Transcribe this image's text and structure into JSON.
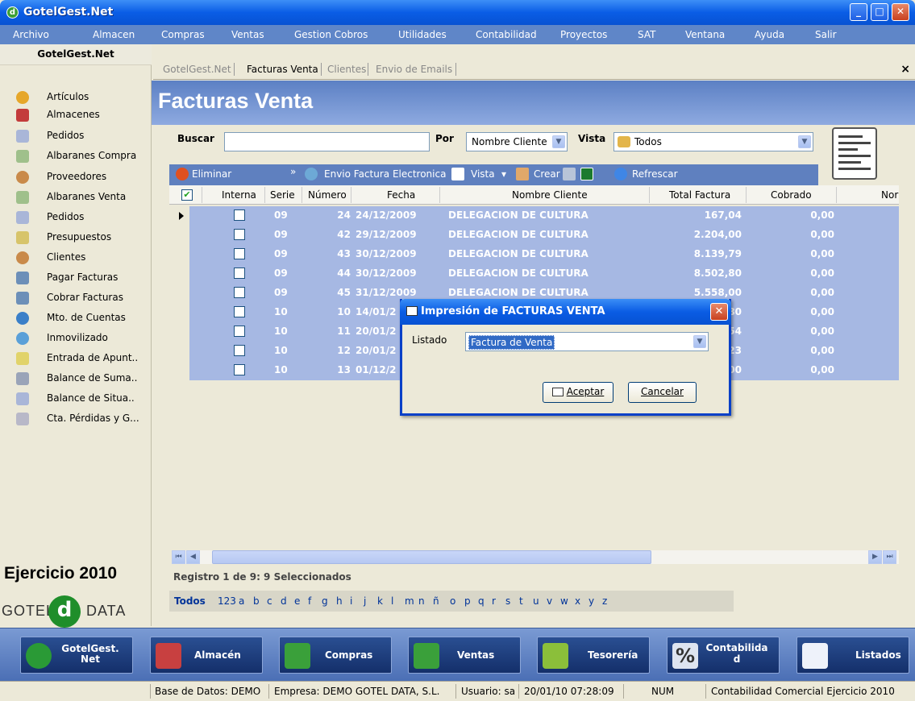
{
  "window": {
    "title": "GotelGest.Net",
    "min": "_",
    "max": "□",
    "close": "✕"
  },
  "menu": [
    {
      "label": "Archivo"
    },
    {
      "label": "Almacen"
    },
    {
      "label": "Compras"
    },
    {
      "label": "Ventas"
    },
    {
      "label": "Gestion Cobros"
    },
    {
      "label": "Utilidades"
    },
    {
      "label": "Contabilidad"
    },
    {
      "label": "Proyectos"
    },
    {
      "label": "SAT"
    },
    {
      "label": "Ventana"
    },
    {
      "label": "Ayuda"
    },
    {
      "label": "Salir"
    }
  ],
  "sidebar": {
    "header": "GotelGest.Net",
    "items": [
      {
        "label": "Artículos"
      },
      {
        "label": "Almacenes"
      },
      {
        "label": "Pedidos"
      },
      {
        "label": "Albaranes Compra"
      },
      {
        "label": "Proveedores"
      },
      {
        "label": "Albaranes Venta"
      },
      {
        "label": "Pedidos"
      },
      {
        "label": "Presupuestos"
      },
      {
        "label": "Clientes"
      },
      {
        "label": "Pagar Facturas"
      },
      {
        "label": "Cobrar Facturas"
      },
      {
        "label": "Mto. de Cuentas"
      },
      {
        "label": "Inmovilizado"
      },
      {
        "label": "Entrada de Apunt.."
      },
      {
        "label": "Balance de Suma.."
      },
      {
        "label": "Balance de Situa.."
      },
      {
        "label": "Cta. Pérdidas y G..."
      }
    ],
    "ejercicio": "Ejercicio 2010",
    "logo_left": "GOTEL",
    "logo_mid": "d",
    "logo_right": "DATA"
  },
  "tabs": [
    {
      "label": "GotelGest.Net"
    },
    {
      "label": "Facturas Venta"
    },
    {
      "label": "Clientes"
    },
    {
      "label": "Envio de Emails"
    }
  ],
  "tab_close": "×",
  "page_title": "Facturas Venta",
  "search": {
    "label": "Buscar",
    "value": "",
    "por_label": "Por",
    "por_value": "Nombre Cliente",
    "vista_label": "Vista",
    "vista_value": "Todos"
  },
  "toolbar": {
    "eliminar": "Eliminar",
    "envio": "Envio Factura Electronica",
    "vista": "Vista",
    "crear": "Crear",
    "refrescar": "Refrescar"
  },
  "grid": {
    "headers": [
      "Interna",
      "Serie",
      "Número",
      "Fecha",
      "Nombre Cliente",
      "Total Factura",
      "Cobrado",
      "Nor"
    ],
    "rows": [
      {
        "serie": "09",
        "numero": "24",
        "fecha": "24/12/2009",
        "cliente": "DELEGACION DE CULTURA",
        "total": "167,04",
        "cobrado": "0,00"
      },
      {
        "serie": "09",
        "numero": "42",
        "fecha": "29/12/2009",
        "cliente": "DELEGACION DE CULTURA",
        "total": "2.204,00",
        "cobrado": "0,00"
      },
      {
        "serie": "09",
        "numero": "43",
        "fecha": "30/12/2009",
        "cliente": "DELEGACION DE CULTURA",
        "total": "8.139,79",
        "cobrado": "0,00"
      },
      {
        "serie": "09",
        "numero": "44",
        "fecha": "30/12/2009",
        "cliente": "DELEGACION DE CULTURA",
        "total": "8.502,80",
        "cobrado": "0,00"
      },
      {
        "serie": "09",
        "numero": "45",
        "fecha": "31/12/2009",
        "cliente": "DELEGACION DE CULTURA",
        "total": "5.558,00",
        "cobrado": "0,00"
      },
      {
        "serie": "10",
        "numero": "10",
        "fecha": "14/01/2",
        "cliente": "",
        "total": "80",
        "cobrado": "0,00"
      },
      {
        "serie": "10",
        "numero": "11",
        "fecha": "20/01/2",
        "cliente": "",
        "total": "54",
        "cobrado": "0,00"
      },
      {
        "serie": "10",
        "numero": "12",
        "fecha": "20/01/2",
        "cliente": "",
        "total": "23",
        "cobrado": "0,00"
      },
      {
        "serie": "10",
        "numero": "13",
        "fecha": "01/12/2",
        "cliente": "",
        "total": "00",
        "cobrado": "0,00"
      }
    ]
  },
  "scroll": {
    "first": "⏮",
    "prev": "◀",
    "next": "▶",
    "last": "⏭"
  },
  "reginfo": "Registro 1 de 9: 9 Seleccionados",
  "alpha": [
    "Todos",
    "123",
    "a",
    "b",
    "c",
    "d",
    "e",
    "f",
    "g",
    "h",
    "i",
    "j",
    "k",
    "l",
    "m",
    "n",
    "ñ",
    "o",
    "p",
    "q",
    "r",
    "s",
    "t",
    "u",
    "v",
    "w",
    "x",
    "y",
    "z"
  ],
  "bottom": [
    {
      "label": "GotelGest. Net"
    },
    {
      "label": "Almacén"
    },
    {
      "label": "Compras"
    },
    {
      "label": "Ventas"
    },
    {
      "label": "Tesorería"
    },
    {
      "label": "Contabilida d"
    },
    {
      "label": "Listados"
    }
  ],
  "status": {
    "db": "Base de Datos: DEMO",
    "empresa": "Empresa: DEMO GOTEL DATA, S.L.",
    "usuario": "Usuario: sa",
    "datetime": "20/01/10 07:28:09",
    "num": "NUM",
    "info": "Contabilidad Comercial Ejercicio 2010"
  },
  "dialog": {
    "title": "Impresión de FACTURAS VENTA",
    "listado_label": "Listado",
    "listado_value": "Factura de Venta",
    "aceptar": "Aceptar",
    "cancelar": "Cancelar",
    "close": "✕"
  },
  "colors": {
    "accent": "#0a5de6",
    "selection": "#a6b8e3",
    "toolbar": "#5f80bf"
  }
}
